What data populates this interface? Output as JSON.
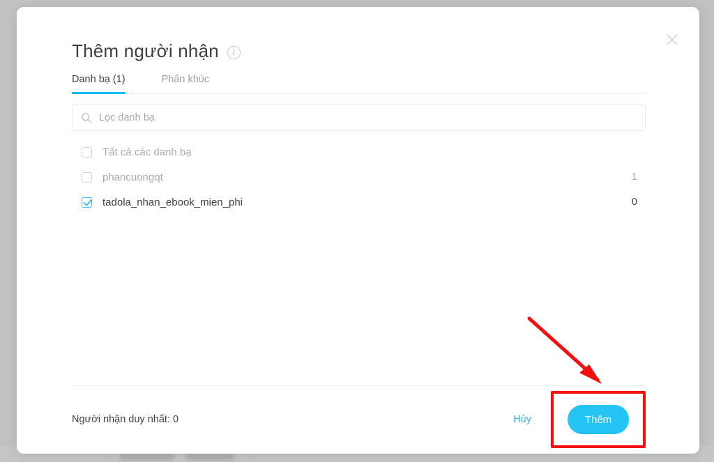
{
  "modal": {
    "title": "Thêm người nhận",
    "info_icon": "info-icon",
    "close_icon": "close-icon",
    "tabs": [
      {
        "label": "Danh bạ (1)",
        "active": true
      },
      {
        "label": "Phân khúc",
        "active": false
      }
    ],
    "search": {
      "placeholder": "Lọc danh bạ",
      "value": "",
      "icon": "search-icon"
    },
    "list": [
      {
        "label": "Tất cả các danh bạ",
        "count": "",
        "checked": false,
        "muted": true
      },
      {
        "label": "phancuongqt",
        "count": "1",
        "checked": false,
        "muted": true
      },
      {
        "label": "tadola_nhan_ebook_mien_phi",
        "count": "0",
        "checked": true,
        "muted": false
      }
    ],
    "footer": {
      "note": "Người nhận duy nhất: 0",
      "cancel_label": "Hủy",
      "submit_label": "Thêm"
    }
  },
  "colors": {
    "accent": "#00bcf2",
    "button": "#24c4f4",
    "link": "#31b0ea",
    "annotation": "#f60f0f",
    "backdrop": "#bfc1c3",
    "text": "#3c4043",
    "muted_text": "#a6abb0"
  }
}
